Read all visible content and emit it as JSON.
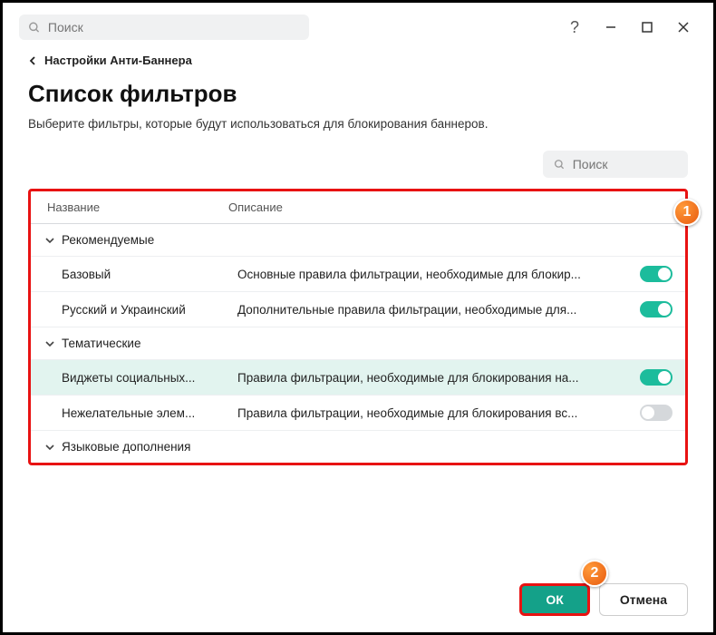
{
  "topbar": {
    "search_placeholder": "Поиск"
  },
  "breadcrumb": {
    "label": "Настройки Анти-Баннера"
  },
  "page": {
    "title": "Список фильтров",
    "subtitle": "Выберите фильтры, которые будут использоваться для блокирования баннеров."
  },
  "search_right": {
    "placeholder": "Поиск"
  },
  "table": {
    "headers": {
      "name": "Название",
      "desc": "Описание"
    },
    "groups": [
      {
        "label": "Рекомендуемые",
        "items": [
          {
            "name": "Базовый",
            "desc": "Основные правила фильтрации, необходимые для блокир...",
            "on": true,
            "selected": false
          },
          {
            "name": "Русский и Украинский",
            "desc": "Дополнительные правила фильтрации, необходимые для...",
            "on": true,
            "selected": false
          }
        ]
      },
      {
        "label": "Тематические",
        "items": [
          {
            "name": "Виджеты социальных...",
            "desc": "Правила фильтрации, необходимые для блокирования на...",
            "on": true,
            "selected": true
          },
          {
            "name": "Нежелательные элем...",
            "desc": "Правила фильтрации, необходимые для блокирования вс...",
            "on": false,
            "selected": false
          }
        ]
      },
      {
        "label": "Языковые дополнения",
        "items": []
      }
    ]
  },
  "footer": {
    "ok": "ОК",
    "cancel": "Отмена"
  },
  "callouts": {
    "one": "1",
    "two": "2"
  }
}
